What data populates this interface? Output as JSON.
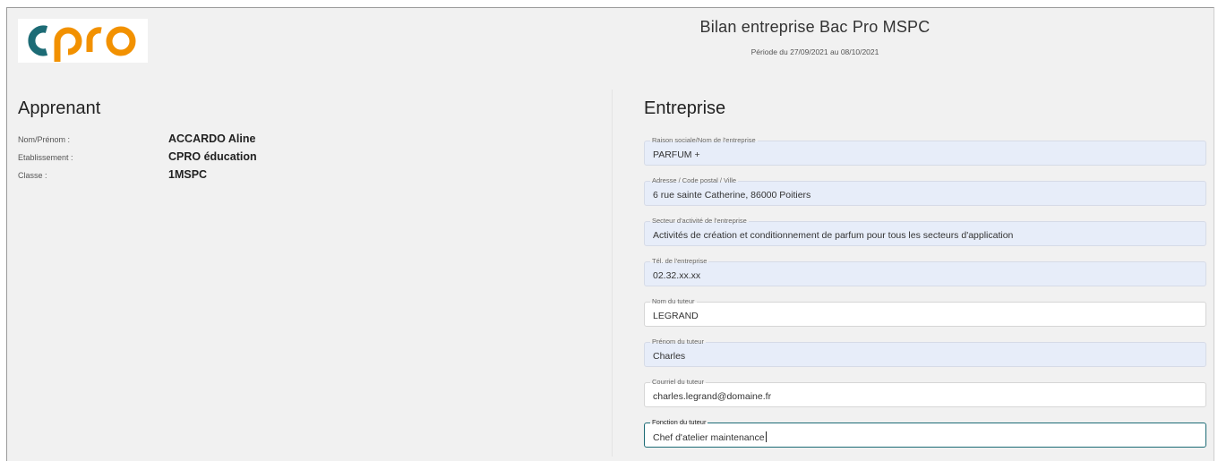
{
  "logo": {
    "text": "cpro",
    "colors": {
      "c": "#1c6b75",
      "pro": "#f29100"
    }
  },
  "header": {
    "title": "Bilan entreprise Bac Pro MSPC",
    "period": "Période du 27/09/2021 au 08/10/2021"
  },
  "apprenant": {
    "heading": "Apprenant",
    "rows": [
      {
        "label": "Nom/Prénom :",
        "value": "ACCARDO Aline"
      },
      {
        "label": "Etablissement :",
        "value": "CPRO éducation"
      },
      {
        "label": "Classe :",
        "value": "1MSPC"
      }
    ]
  },
  "entreprise": {
    "heading": "Entreprise",
    "fields": [
      {
        "label": "Raison sociale/Nom de l'entreprise",
        "value": "PARFUM +"
      },
      {
        "label": "Adresse / Code postal / Ville",
        "value": "6 rue sainte Catherine, 86000 Poitiers"
      },
      {
        "label": "Secteur d'activité de l'entreprise",
        "value": "Activités de création et conditionnement de parfum pour tous les secteurs d'application"
      },
      {
        "label": "Tél. de l'entreprise",
        "value": "02.32.xx.xx"
      },
      {
        "label": "Nom du tuteur",
        "value": "LEGRAND"
      },
      {
        "label": "Prénom du tuteur",
        "value": "Charles"
      },
      {
        "label": "Courriel du tuteur",
        "value": "charles.legrand@domaine.fr"
      },
      {
        "label": "Fonction du tuteur",
        "value": "Chef d'atelier maintenance"
      }
    ]
  },
  "colors": {
    "page_bg": "#f1f1f1",
    "field_filled_bg": "#e7edf9",
    "field_focus_border": "#1c6b75"
  }
}
